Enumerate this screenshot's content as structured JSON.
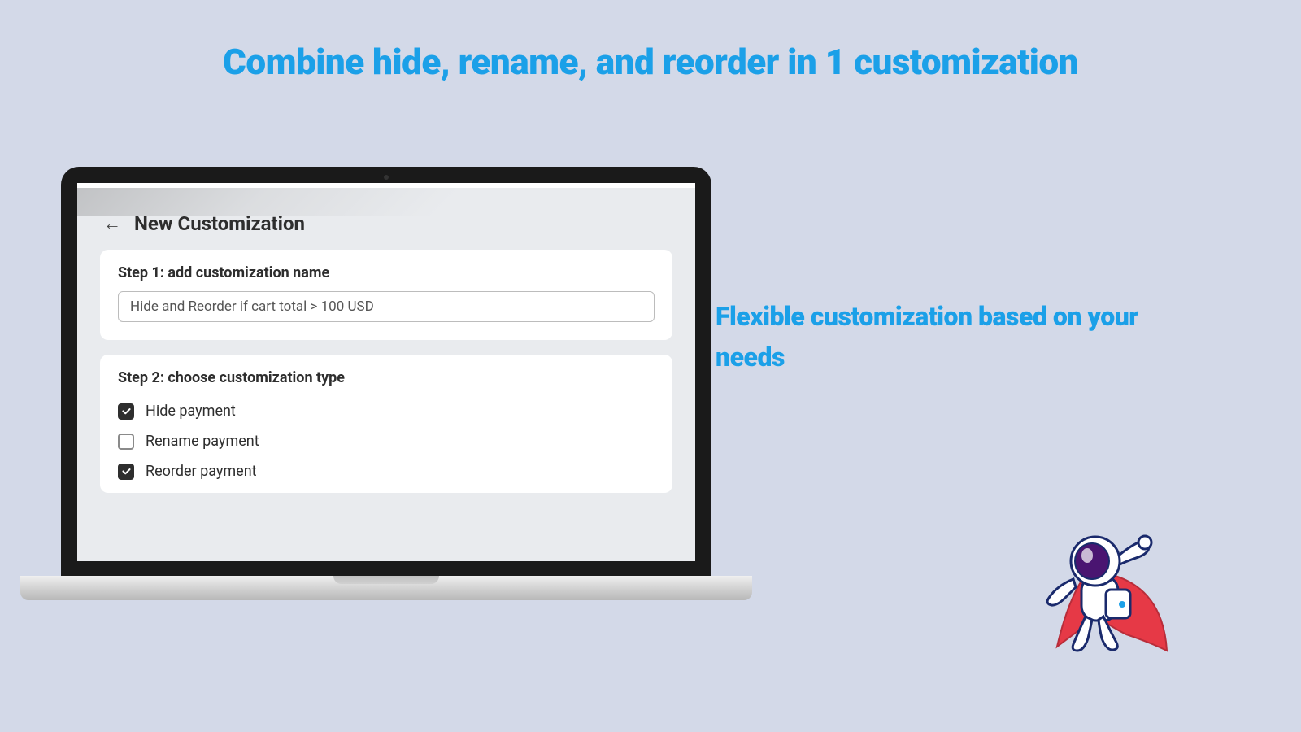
{
  "heading": "Combine hide, rename, and reorder in 1 customization",
  "sideText": "Flexible customization based on your needs",
  "screen": {
    "pageTitle": "New Customization",
    "step1": {
      "label": "Step 1: add customization name",
      "value": "Hide and Reorder if cart total > 100 USD"
    },
    "step2": {
      "label": "Step 2: choose customization type",
      "options": [
        {
          "label": "Hide payment",
          "checked": true
        },
        {
          "label": "Rename payment",
          "checked": false
        },
        {
          "label": "Reorder payment",
          "checked": true
        }
      ]
    }
  }
}
